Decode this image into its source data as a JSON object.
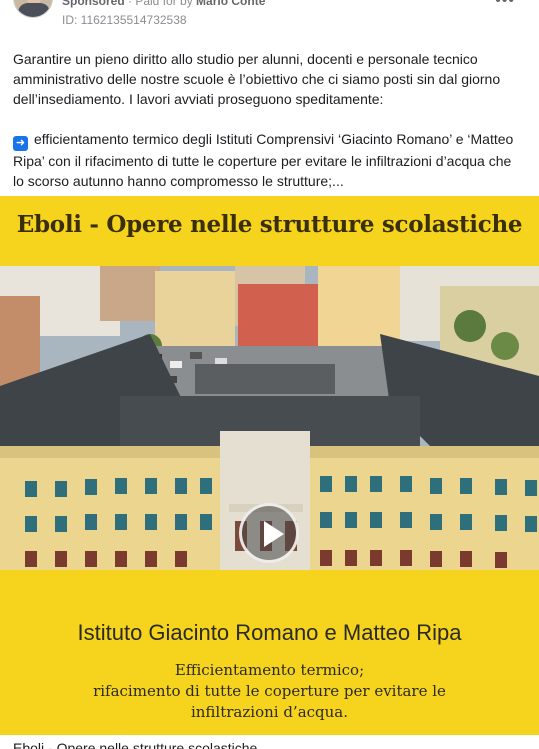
{
  "header": {
    "sponsored": "Sponsored",
    "paid_for_by_prefix": " · Paid for by ",
    "advertiser": "Mario Conte",
    "ad_id": "ID: 1162135514732538",
    "more_icon": "more-options-icon"
  },
  "post": {
    "paragraph1": "Garantire un pieno diritto allo studio per alunni, docenti e personale tecnico amministrativo delle nostre scuole è l’obiettivo che ci siamo posti sin dal giorno dell’insediamento. I lavori avviati proseguono speditamente:",
    "arrow_emoji": "➡",
    "paragraph2": "efficientamento termico degli Istituti Comprensivi ‘Giacinto Romano’ e ‘Matteo Ripa’ con il rifacimento di tutte le coperture per evitare le infiltrazioni d’acqua che lo scorso autunno hanno compromesso le strutture;..."
  },
  "media": {
    "title": "Eboli - Opere nelle strutture scolastiche",
    "school_sign": "Istituto Comprensivo \"Matteo Ripa\"",
    "caption_title": "Istituto Giacinto Romano e Matteo Ripa",
    "caption_line1": "Efficientamento termico;",
    "caption_line2": "rifacimento di tutte le coperture per evitare le",
    "caption_line3": "infiltrazioni d’acqua.",
    "background_color": "#f6d41d"
  },
  "footer": {
    "video_title": "Eboli - Opere nelle strutture scolastiche"
  }
}
